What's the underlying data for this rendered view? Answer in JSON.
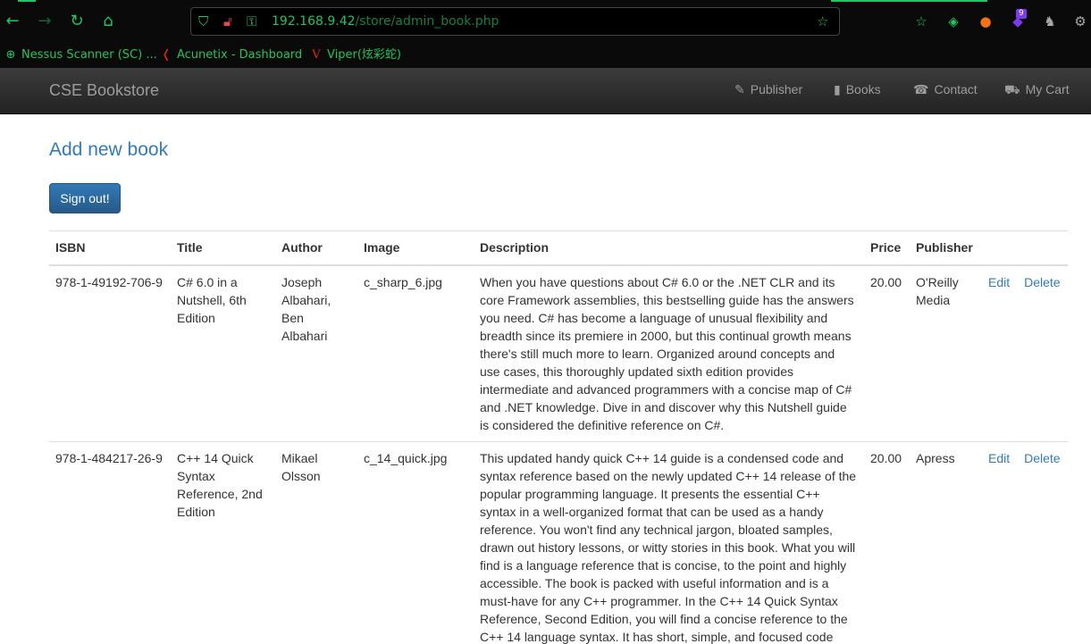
{
  "browser": {
    "url_host": "192.168.9.42",
    "url_path": "/store/admin_book.php",
    "extension_badge": "9",
    "icons": [
      "back-icon",
      "forward-icon",
      "reload-icon",
      "home-icon",
      "shield-icon",
      "lock-icon",
      "key-icon",
      "bookmark-star-icon",
      "extension-icon",
      "pocket-icon",
      "fox-icon",
      "puzzle-icon",
      "profile-icon"
    ],
    "bookmarks": [
      {
        "label": "Nessus Scanner (SC) ...",
        "icon": "globe-icon"
      },
      {
        "label": "Acunetix - Dashboard",
        "icon": "acunetix-icon"
      },
      {
        "label": "Viper(炫彩蛇)",
        "icon": "viper-icon"
      }
    ],
    "accent": "#22c55e"
  },
  "navbar": {
    "brand": "CSE Bookstore",
    "links": [
      {
        "label": "Publisher",
        "icon": "paperclip-icon"
      },
      {
        "label": "Books",
        "icon": "book-icon"
      },
      {
        "label": "Contact",
        "icon": "phone-icon"
      },
      {
        "label": "My Cart",
        "icon": "cart-icon"
      }
    ]
  },
  "main": {
    "heading": "Add new book",
    "signout_label": "Sign out!",
    "columns": [
      "ISBN",
      "Title",
      "Author",
      "Image",
      "Description",
      "Price",
      "Publisher"
    ],
    "edit_label": "Edit",
    "delete_label": "Delete",
    "rows": [
      {
        "isbn": "978-1-49192-706-9",
        "title": "C# 6.0 in a Nutshell, 6th Edition",
        "author": "Joseph Albahari, Ben Albahari",
        "image": "c_sharp_6.jpg",
        "description": "When you have questions about C# 6.0 or the .NET CLR and its core Framework assemblies, this bestselling guide has the answers you need. C# has become a language of unusual flexibility and breadth since its premiere in 2000, but this continual growth means there's still much more to learn. Organized around concepts and use cases, this thoroughly updated sixth edition provides intermediate and advanced programmers with a concise map of C# and .NET knowledge. Dive in and discover why this Nutshell guide is considered the definitive reference on C#.",
        "price": "20.00",
        "publisher": "O'Reilly Media"
      },
      {
        "isbn": "978-1-484217-26-9",
        "title": "C++ 14 Quick Syntax Reference, 2nd Edition",
        "author": "Mikael Olsson",
        "image": "c_14_quick.jpg",
        "description": "This updated handy quick C++ 14 guide is a condensed code and syntax reference based on the newly updated C++ 14 release of the popular programming language. It presents the essential C++ syntax in a well-organized format that can be used as a handy reference. You won't find any technical jargon, bloated samples, drawn out history lessons, or witty stories in this book. What you will find is a language reference that is concise, to the point and highly accessible. The book is packed with useful information and is a must-have for any C++ programmer. In the C++ 14 Quick Syntax Reference, Second Edition, you will find a concise reference to the C++ 14 language syntax. It has short, simple, and focused code",
        "price": "20.00",
        "publisher": "Apress"
      }
    ]
  }
}
